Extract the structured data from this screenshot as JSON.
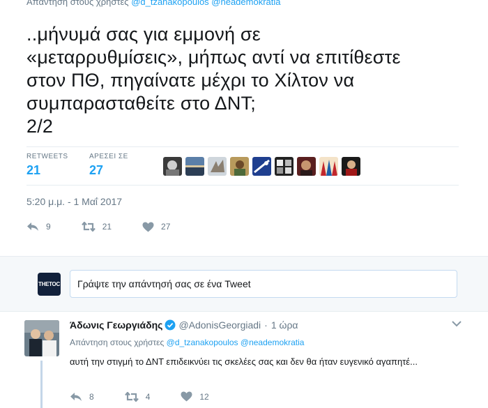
{
  "top_reply_context": {
    "prefix": "Απάντηση στους χρήστες",
    "handles": "@d_tzanakopoulos @neademokratia"
  },
  "tweet": {
    "text": "..μήνυμά σας για εμμονή σε\n«μεταρρυθμίσεις», μήπως αντί να επιτίθεστε\nστον ΠΘ, πηγαίνατε μέχρι το Χίλτον να\nσυμπαρασταθείτε στο ΔΝΤ;\n2/2",
    "stats": {
      "retweets_label": "RETWEETS",
      "retweets_value": "21",
      "likes_label": "ΑΡΕΣΕΙ ΣΕ",
      "likes_value": "27"
    },
    "liker_avatars": [
      "avatar-1",
      "avatar-2",
      "avatar-3",
      "avatar-4",
      "avatar-5",
      "avatar-6",
      "avatar-7",
      "avatar-8",
      "avatar-9"
    ],
    "timestamp": "5:20 μ.μ. - 1 Μαΐ 2017",
    "actions": {
      "replies": "9",
      "retweets": "21",
      "likes": "27"
    }
  },
  "reply_box": {
    "avatar_text": "THETOC",
    "placeholder": "Γράψτε την απάντησή σας σε ένα Tweet"
  },
  "reply": {
    "name": "Άδωνις Γεωργιάδης",
    "handle": "@AdonisGeorgiadi",
    "time": "1 ώρα",
    "context_prefix": "Απάντηση στους χρήστες",
    "context_handles": "@d_tzanakopoulos @neademokratia",
    "text": "αυτή την στιγμή το ΔΝΤ επιδεικνύει τις σκελέες σας και δεν θα ήταν ευγενικό αγαπητέ...",
    "actions": {
      "replies": "8",
      "retweets": "4",
      "likes": "12"
    }
  },
  "colors": {
    "accent": "#1da1f2",
    "muted": "#657786",
    "verified": "#1da1f2"
  }
}
